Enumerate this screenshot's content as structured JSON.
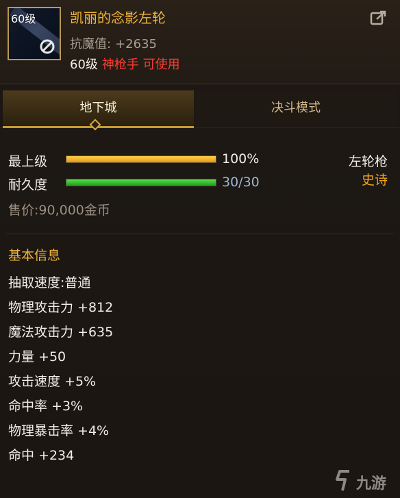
{
  "item": {
    "icon_level_label": "60级",
    "name": "凯丽的念影左轮",
    "stat_label": "抗魔值:",
    "stat_value": "+2635",
    "req_level": "60级",
    "req_class": "神枪手 可使用",
    "icons": {
      "lock": "no-entry-icon",
      "share": "share-icon"
    }
  },
  "tabs": [
    {
      "label": "地下城",
      "active": true
    },
    {
      "label": "决斗模式",
      "active": false
    }
  ],
  "bars": {
    "upgrade": {
      "label": "最上级",
      "value_text": "100%",
      "value": 1.0
    },
    "durability": {
      "label": "耐久度",
      "value_text": "30/30",
      "value": 1.0
    }
  },
  "classification": {
    "type": "左轮枪",
    "rarity": "史诗"
  },
  "price": "售价:90,000金币",
  "basic_info": {
    "title": "基本信息",
    "lines": [
      "抽取速度:普通",
      "物理攻击力 +812",
      "魔法攻击力 +635",
      "力量 +50",
      "攻击速度 +5%",
      "命中率 +3%",
      "物理暴击率 +4%",
      "命中 +234"
    ]
  },
  "watermark": "九游",
  "colors": {
    "title": "#f0b53a",
    "class_red": "#ff3b30",
    "rarity": "#f1a419",
    "bar_orange": "#f0b020",
    "bar_green": "#3cc534"
  }
}
